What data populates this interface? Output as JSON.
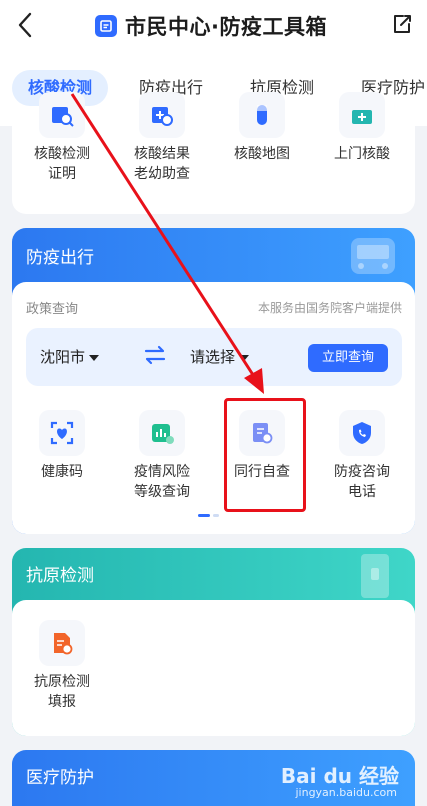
{
  "header": {
    "title": "市民中心·防疫工具箱"
  },
  "tabs": [
    {
      "label": "核酸检测",
      "active": true
    },
    {
      "label": "防疫出行"
    },
    {
      "label": "抗原检测"
    },
    {
      "label": "医疗防护"
    }
  ],
  "nucleic": {
    "items": [
      {
        "label_line1": "核酸检测",
        "label_line2": "证明",
        "icon": "certificate-search-icon"
      },
      {
        "label_line1": "核酸结果",
        "label_line2": "老幼助查",
        "icon": "result-search-icon"
      },
      {
        "label_line1": "核酸地图",
        "label_line2": "",
        "icon": "map-tube-icon"
      },
      {
        "label_line1": "上门核酸",
        "label_line2": "",
        "icon": "home-medical-icon"
      }
    ]
  },
  "travel": {
    "title": "防疫出行",
    "policy_label": "政策查询",
    "provider": "本服务由国务院客户端提供",
    "city": "沈阳市",
    "select_placeholder": "请选择",
    "query_button": "立即查询",
    "items": [
      {
        "label_line1": "健康码",
        "label_line2": "",
        "icon": "health-code-icon"
      },
      {
        "label_line1": "疫情风险",
        "label_line2": "等级查询",
        "icon": "risk-level-icon"
      },
      {
        "label_line1": "同行自查",
        "label_line2": "",
        "icon": "trip-check-icon"
      },
      {
        "label_line1": "防疫咨询",
        "label_line2": "电话",
        "icon": "phone-shield-icon"
      }
    ]
  },
  "antigen": {
    "title": "抗原检测",
    "items": [
      {
        "label_line1": "抗原检测",
        "label_line2": "填报",
        "icon": "report-form-icon"
      }
    ]
  },
  "medical": {
    "title": "医疗防护"
  },
  "watermark": {
    "brand": "Bai du 经验",
    "url": "jingyan.baidu.com"
  },
  "colors": {
    "accent": "#2f6bff",
    "teal": "#24b6b0",
    "highlight": "#e8111a"
  }
}
